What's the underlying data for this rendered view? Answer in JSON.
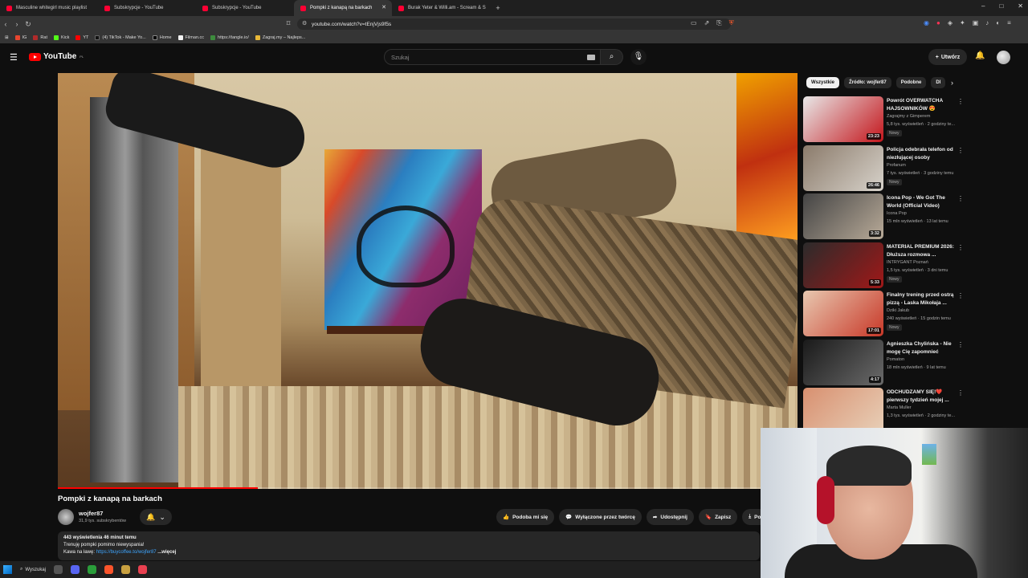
{
  "browser": {
    "tabs": [
      {
        "label": "Masculine whitegirl music playlist",
        "active": false
      },
      {
        "label": "Subskrypcje - YouTube",
        "active": false
      },
      {
        "label": "Subskrypcje - YouTube",
        "active": false
      },
      {
        "label": "Pompki z kanapą na barkach",
        "active": true
      },
      {
        "label": "Burak Yeter & Willi.am - Scream & S",
        "active": false
      }
    ],
    "new_tab": "+",
    "window_controls": [
      "–",
      "□",
      "✕"
    ],
    "url": "youtube.com/watch?v=tEnjVjs9f5s",
    "bookmarks": [
      "IG",
      "Rat",
      "Kick",
      "YT",
      "(4) TikTok - Make Yo...",
      "Home",
      "Filman.cc",
      "https://tangle.io/",
      "Zagraj.my – Najleps..."
    ]
  },
  "yt_header": {
    "logo_text": "YouTube",
    "region": "PL",
    "search_placeholder": "Szukaj",
    "create_label": "Utwórz"
  },
  "video": {
    "title": "Pompki z kanapą na barkach",
    "progress": 0.27,
    "channel_name": "wojfer87",
    "channel_subs": "31,9 tys. subskrybentów",
    "actions": [
      "Podoba mi się",
      "Wyłączone przez twórcę",
      "Udostępnij",
      "Zapisz",
      "Po"
    ],
    "description": {
      "meta": "443 wyświetlenia  46 minut temu",
      "line1": "Trenuję pompki pomimo niewyspania!",
      "line2_prefix": "Kawa na ławę: ",
      "link": "https://buycoffee.to/wojfer87",
      "more": " ...więcej"
    }
  },
  "sidebar": {
    "chips": [
      "Wszystkie",
      "Źródło: wojfer87",
      "Podobne",
      "Dl"
    ],
    "recommendations": [
      {
        "title": "Powrót OVERWATCHA HAJSOWNIKÓW 😍",
        "channel": "Zagrajmy z Gimperem",
        "meta": "5,8 tys. wyświetleń · 2 godziny te...",
        "badge": "Nowy",
        "duration": "23:23",
        "color_a": "#e8e8e8",
        "color_b": "#c4161c"
      },
      {
        "title": "Policja odebrała telefon od niezłującej osoby",
        "channel": "Profanum",
        "meta": "7 tys. wyświetleń · 3 godziny temu",
        "badge": "Nowy",
        "duration": "26:46",
        "color_a": "#8b7b6b",
        "color_b": "#d7d2ca"
      },
      {
        "title": "Icona Pop - We Got The World (Official Video)",
        "channel": "Icona Pop",
        "meta": "15 mln wyświetleń · 13 lat temu",
        "badge": "",
        "duration": "3:32",
        "color_a": "#444",
        "color_b": "#b8aa98"
      },
      {
        "title": "MATERIAL PREMIUM 2026: Dłuższa rozmowa ...",
        "channel": "INTRYGANT Poznań",
        "meta": "1,5 tys. wyświetleń · 3 dni temu",
        "badge": "Nowy",
        "duration": "5:33",
        "color_a": "#2b2b2b",
        "color_b": "#a01818"
      },
      {
        "title": "Finalny trening przed ostrą pizzą - Laska Mikołaja ...",
        "channel": "Dziki Jakub",
        "meta": "240 wyświetleń · 15 godzin temu",
        "badge": "Nowy",
        "duration": "17:01",
        "color_a": "#e8c8b0",
        "color_b": "#c83828"
      },
      {
        "title": "Agnieszka Chylińska - Nie mogę Cię zapomnieć",
        "channel": "Pomaton",
        "meta": "18 mln wyświetleń · 9 lat temu",
        "badge": "",
        "duration": "4:17",
        "color_a": "#1a1a1a",
        "color_b": "#6a6a6a"
      },
      {
        "title": "ODCHUDZAMY SIĘ!❤️ pierwszy tydzień mojej ...",
        "channel": "Marta Muller",
        "meta": "1,3 tys. wyświetleń · 2 godziny te...",
        "badge": "",
        "duration": "",
        "color_a": "#d89070",
        "color_b": "#e8d0b8"
      }
    ]
  },
  "taskbar": {
    "search_label": "Wyszukaj"
  },
  "colors": {
    "accent": "#ff0000",
    "link": "#3ea6ff",
    "background": "#0f0f0f"
  }
}
